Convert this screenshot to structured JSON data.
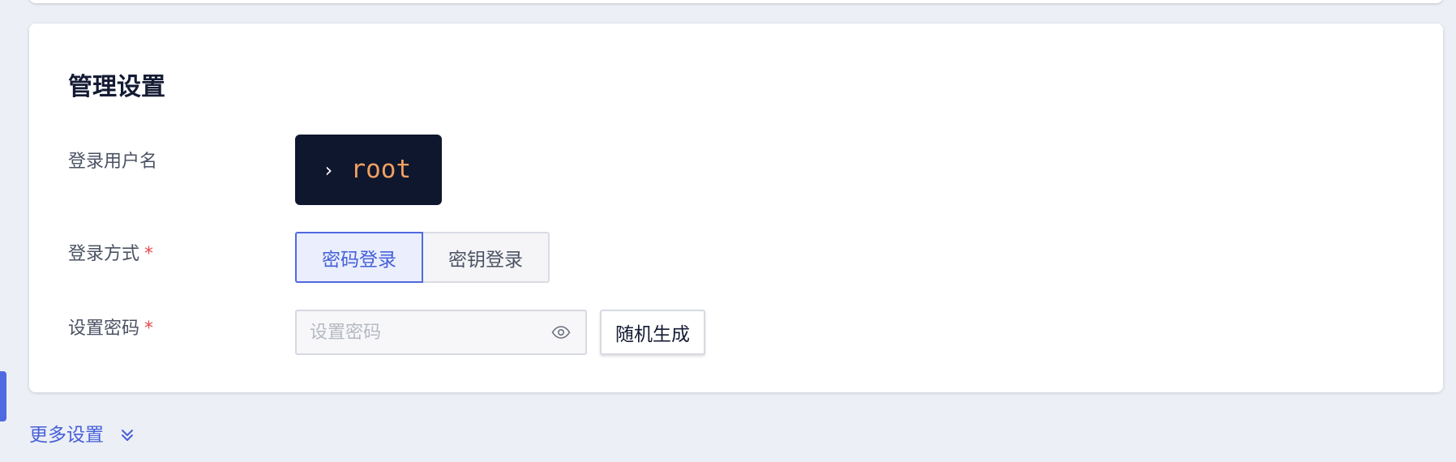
{
  "section": {
    "title": "管理设置"
  },
  "fields": {
    "username": {
      "label": "登录用户名",
      "value": "root",
      "prompt_icon": "chevron-right-icon"
    },
    "login_method": {
      "label": "登录方式",
      "required_mark": "*",
      "options": [
        "密码登录",
        "密钥登录"
      ],
      "selected": "密码登录"
    },
    "password": {
      "label": "设置密码",
      "required_mark": "*",
      "placeholder": "设置密码",
      "value": "",
      "toggle_icon": "eye-icon",
      "generate_label": "随机生成"
    }
  },
  "more_settings": {
    "label": "更多设置",
    "icon": "double-chevron-down-icon"
  },
  "colors": {
    "accent": "#4f6ae0",
    "required": "#e5484d",
    "terminal_bg": "#0f172e",
    "terminal_text": "#f0a060",
    "page_bg": "#edeff6"
  }
}
